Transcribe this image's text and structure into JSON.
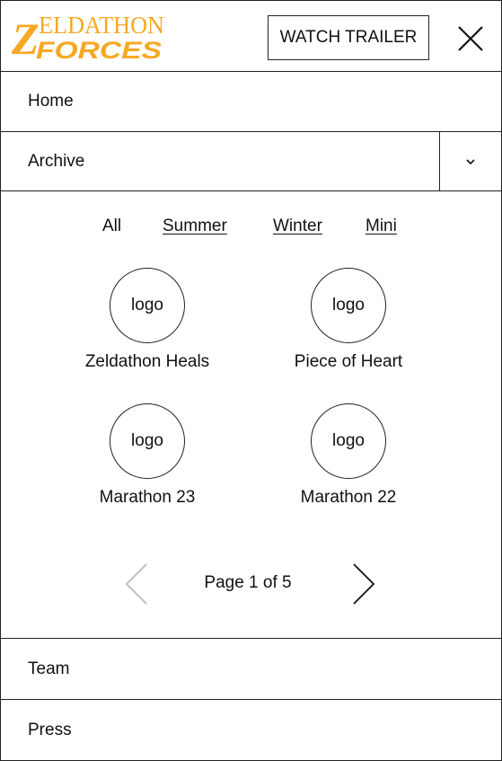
{
  "header": {
    "logo_line1": "ELDATHON",
    "logo_initial": "Z",
    "logo_line2": "FORCES",
    "trailer_label": "WATCH TRAILER",
    "close_icon": "close-icon"
  },
  "nav": {
    "home": "Home",
    "archive": "Archive",
    "archive_toggle_icon": "chevron-down-icon",
    "team": "Team",
    "press": "Press"
  },
  "archive": {
    "filters": [
      "All",
      "Summer",
      "Winter",
      "Mini"
    ],
    "active_filter": "All",
    "events": [
      {
        "logo": "logo",
        "name": "Zeldathon Heals"
      },
      {
        "logo": "logo",
        "name": "Piece of Heart"
      },
      {
        "logo": "logo",
        "name": "Marathon 23"
      },
      {
        "logo": "logo",
        "name": "Marathon 22"
      }
    ],
    "pager": {
      "text": "Page 1 of 5",
      "prev_icon": "chevron-left-icon",
      "next_icon": "chevron-right-icon",
      "prev_enabled": false
    }
  },
  "colors": {
    "brand": "#F7A823",
    "border": "#222222",
    "disabled": "#BBBBBB"
  }
}
